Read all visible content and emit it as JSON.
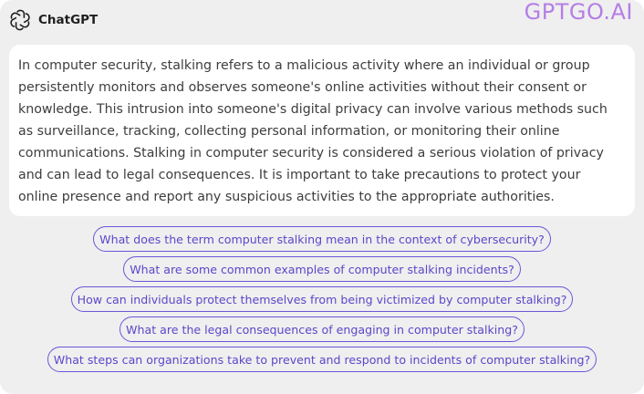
{
  "header": {
    "app_title": "ChatGPT",
    "logo_icon": "openai-logo-icon"
  },
  "watermark": "GPTGO.AI",
  "answer": {
    "text": "In computer security, stalking refers to a malicious activity where an individual or group persistently monitors and observes someone's online activities without their consent or knowledge. This intrusion into someone's digital privacy can involve various methods such as surveillance, tracking, collecting personal information, or monitoring their online communications. Stalking in computer security is considered a serious violation of privacy and can lead to legal consequences. It is important to take precautions to protect your online presence and report any suspicious activities to the appropriate authorities."
  },
  "suggestions": [
    "What does the term computer stalking mean in the context of cybersecurity?",
    "What are some common examples of computer stalking incidents?",
    "How can individuals protect themselves from being victimized by computer stalking?",
    "What are the legal consequences of engaging in computer stalking?",
    "What steps can organizations take to prevent and respond to incidents of computer stalking?"
  ],
  "colors": {
    "watermark": "#b47ee6",
    "chip_border": "#6a57d8",
    "chip_text": "#5b47c9",
    "background": "#efefef",
    "card": "#ffffff"
  }
}
